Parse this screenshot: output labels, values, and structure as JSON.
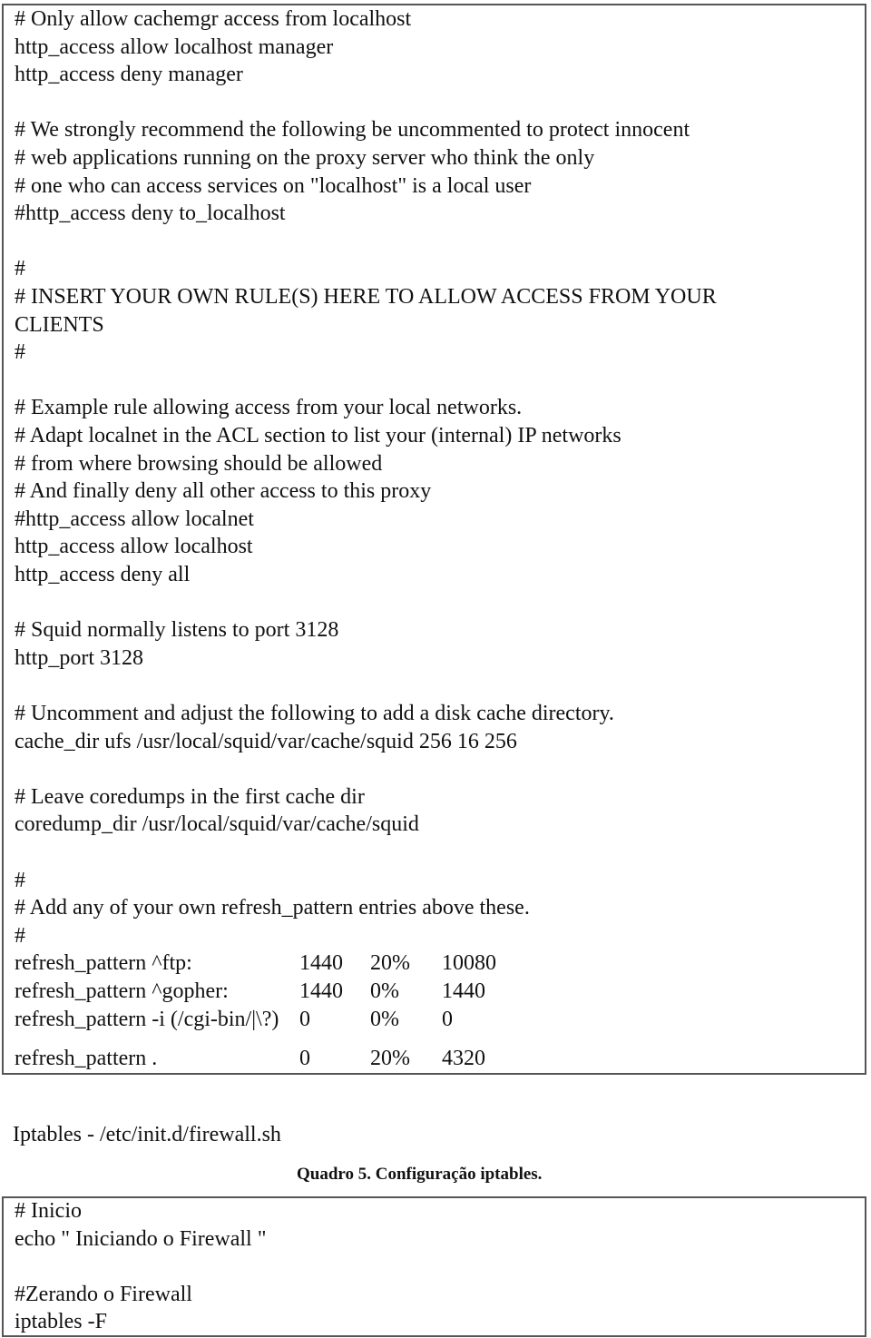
{
  "squid_config_box": {
    "lines": [
      "# Only allow cachemgr access from localhost",
      "http_access allow localhost manager",
      "http_access deny manager",
      "",
      "# We strongly recommend the following be uncommented to protect innocent",
      "# web applications running on the proxy server who think the only",
      "# one who can access services on \"localhost\" is a local user",
      "#http_access deny to_localhost",
      "",
      "#",
      "# INSERT YOUR OWN RULE(S) HERE TO ALLOW ACCESS FROM YOUR",
      "CLIENTS",
      "#",
      "",
      "# Example rule allowing access from your local networks.",
      "# Adapt localnet in the ACL section to list your (internal) IP networks",
      "# from where browsing should be allowed",
      "# And finally deny all other access to this proxy",
      "#http_access allow localnet",
      "http_access allow localhost",
      "http_access deny all",
      "",
      "# Squid normally listens to port 3128",
      "http_port 3128",
      "",
      "# Uncomment and adjust the following to add a disk cache directory.",
      "cache_dir ufs /usr/local/squid/var/cache/squid 256 16 256",
      "",
      "# Leave coredumps in the first cache dir",
      "coredump_dir /usr/local/squid/var/cache/squid",
      "",
      "#",
      "# Add any of your own refresh_pattern entries above these.",
      "#"
    ],
    "refresh_patterns": [
      [
        "refresh_pattern ^ftp:",
        "1440",
        "20%",
        "10080"
      ],
      [
        "refresh_pattern ^gopher:",
        "1440",
        "0%",
        "1440"
      ],
      [
        "refresh_pattern -i (/cgi-bin/|\\?)",
        "0",
        "0%",
        "0"
      ],
      [
        "refresh_pattern .",
        "0",
        "20%",
        "4320"
      ]
    ]
  },
  "iptables_heading": "Iptables - /etc/init.d/firewall.sh",
  "caption": "Quadro 5. Configuração iptables.",
  "firewall_box": {
    "lines": [
      "# Inicio",
      "echo \" Iniciando o Firewall \"",
      "",
      "#Zerando o Firewall",
      "iptables -F"
    ]
  }
}
